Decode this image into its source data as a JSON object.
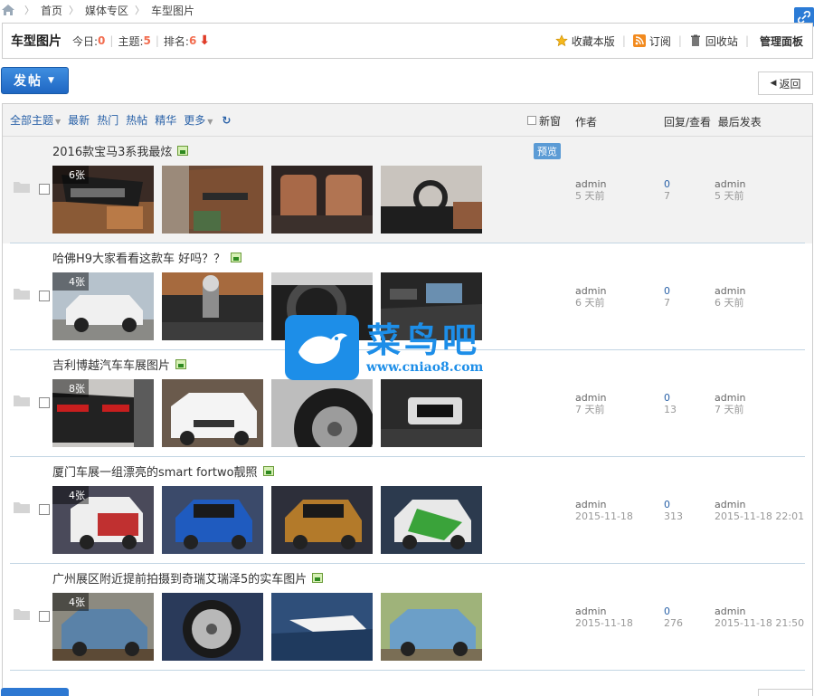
{
  "breadcrumb": {
    "items": [
      "首页",
      "媒体专区",
      "车型图片"
    ]
  },
  "forum": {
    "title": "车型图片",
    "today_label": "今日:",
    "today_value": "0",
    "topics_label": "主题:",
    "topics_value": "5",
    "rank_label": "排名:",
    "rank_value": "6",
    "actions": {
      "favorite": "收藏本版",
      "subscribe": "订阅",
      "recycle": "回收站",
      "admin": "管理面板"
    }
  },
  "toolbar": {
    "post_label": "发帖",
    "back_label": "返回"
  },
  "filters": {
    "all_topics": "全部主题",
    "latest": "最新",
    "hot": "热门",
    "popular": "热帖",
    "digest": "精华",
    "more": "更多",
    "new_window": "新窗",
    "author_col": "作者",
    "reply_col": "回复/查看",
    "last_col": "最后发表"
  },
  "threads": [
    {
      "title": "2016款宝马3系我最炫",
      "preview": "预览",
      "count": "6张",
      "author": "admin",
      "author_time": "5 天前",
      "replies": "0",
      "views": "7",
      "last_user": "admin",
      "last_time": "5 天前"
    },
    {
      "title": "哈佛H9大家看看这款车 好吗？？",
      "count": "4张",
      "author": "admin",
      "author_time": "6 天前",
      "replies": "0",
      "views": "7",
      "last_user": "admin",
      "last_time": "6 天前"
    },
    {
      "title": "吉利博越汽车车展图片",
      "count": "8张",
      "author": "admin",
      "author_time": "7 天前",
      "replies": "0",
      "views": "13",
      "last_user": "admin",
      "last_time": "7 天前"
    },
    {
      "title": "厦门车展一组漂亮的smart fortwo靓照",
      "count": "4张",
      "author": "admin",
      "author_time": "2015-11-18",
      "replies": "0",
      "views": "313",
      "last_user": "admin",
      "last_time": "2015-11-18 22:01"
    },
    {
      "title": "广州展区附近提前拍摄到奇瑞艾瑞泽5的实车图片",
      "count": "4张",
      "author": "admin",
      "author_time": "2015-11-18",
      "replies": "0",
      "views": "276",
      "last_user": "admin",
      "last_time": "2015-11-18 21:50"
    }
  ],
  "watermark": {
    "brand": "菜鸟吧",
    "url": "www.cniao8.com"
  },
  "colors": {
    "accent": "#2a62a8",
    "button": "#1f67c3",
    "highlight_num": "#f26c4f"
  }
}
